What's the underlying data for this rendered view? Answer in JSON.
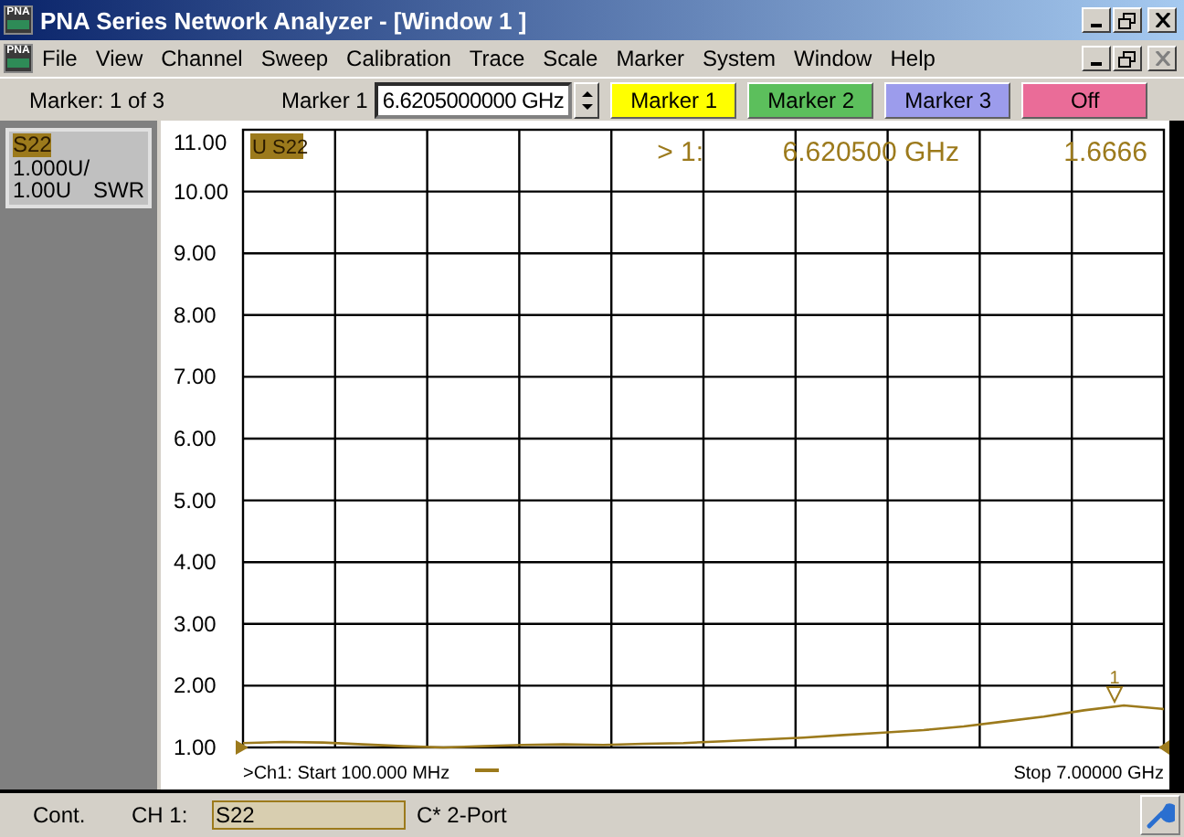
{
  "window": {
    "icon_label": "PNA",
    "title": "PNA Series Network Analyzer - [Window 1 ]"
  },
  "menu_bar": {
    "icon_label": "PNA",
    "items": [
      "File",
      "View",
      "Channel",
      "Sweep",
      "Calibration",
      "Trace",
      "Scale",
      "Marker",
      "System",
      "Window",
      "Help"
    ],
    "close_disabled": true
  },
  "toolbar": {
    "marker_count": "Marker: 1 of 3",
    "marker_label": "Marker 1",
    "marker_value": "6.6205000000 GHz",
    "buttons": [
      {
        "label": "Marker 1",
        "color": "#ffff00"
      },
      {
        "label": "Marker 2",
        "color": "#5cbf5c"
      },
      {
        "label": "Marker 3",
        "color": "#9c9cec"
      },
      {
        "label": "Off",
        "color": "#ea6c98"
      }
    ]
  },
  "trace_info": {
    "name": "S22",
    "scale": "1.000U/",
    "reference": "1.00U",
    "format": "SWR"
  },
  "plot": {
    "trace_label": "U S22",
    "marker_readout": {
      "marker": "> 1:",
      "frequency": "6.620500 GHz",
      "value": "1.6666"
    },
    "start_label": ">Ch1: Start  100.000 MHz",
    "stop_label": "Stop  7.00000 GHz",
    "marker_label": "1",
    "chart_data": {
      "type": "line",
      "grid": true,
      "ylim": [
        1,
        11
      ],
      "categories": [
        null,
        null,
        null,
        null,
        null,
        null,
        null,
        null,
        null,
        null,
        null,
        null,
        null,
        null,
        null,
        null,
        null,
        null,
        null,
        null,
        null,
        null,
        null,
        null
      ],
      "series": [
        {
          "color": "#9c7a1c",
          "values": [
            1.07,
            1.09,
            1.08,
            1.05,
            1.02,
            1.0,
            1.02,
            1.04,
            1.05,
            1.04,
            1.06,
            1.07,
            1.1,
            1.13,
            1.16,
            1.2,
            1.24,
            1.28,
            1.34,
            1.42,
            1.5,
            1.6,
            1.68,
            1.62
          ]
        }
      ],
      "yticks": [
        {
          "value": 11,
          "label": "11.00"
        },
        {
          "value": 10,
          "label": "10.00"
        },
        {
          "value": 9,
          "label": "9.00"
        },
        {
          "value": 8,
          "label": "8.00"
        },
        {
          "value": 7,
          "label": "7.00"
        },
        {
          "value": 6,
          "label": "6.00"
        },
        {
          "value": 5,
          "label": "5.00"
        },
        {
          "value": 4,
          "label": "4.00"
        },
        {
          "value": 3,
          "label": "3.00"
        },
        {
          "value": 2,
          "label": "2.00"
        },
        {
          "value": 1,
          "label": "1.00"
        }
      ]
    }
  },
  "status_bar": {
    "mode": "Cont.",
    "channel": "CH 1:",
    "measurement": "S22",
    "calibration": "C* 2-Port"
  }
}
